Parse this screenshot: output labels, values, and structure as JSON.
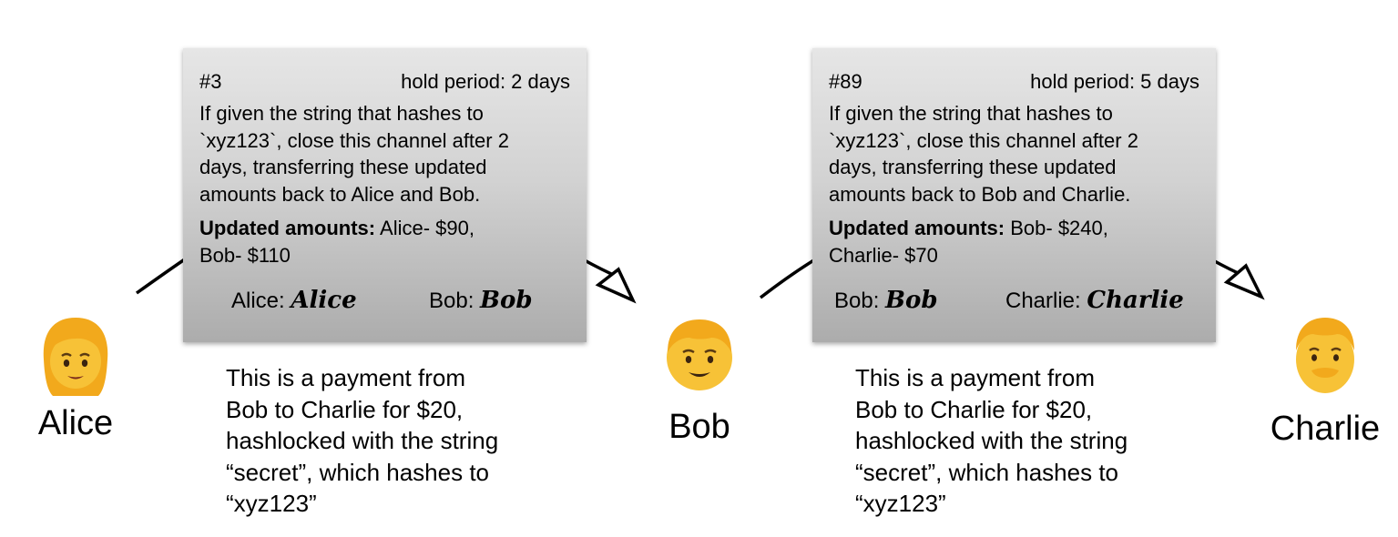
{
  "people": [
    {
      "name": "Alice",
      "emoji": "woman"
    },
    {
      "name": "Bob",
      "emoji": "boy"
    },
    {
      "name": "Charlie",
      "emoji": "man"
    }
  ],
  "cards": [
    {
      "number": "#3",
      "hold_period": "hold period: 2 days",
      "body_lines": [
        "If given the string that hashes to",
        "`xyz123`, close this channel after 2",
        "days, transferring these updated",
        "amounts back to Alice and Bob."
      ],
      "amounts_label": "Updated amounts:",
      "amounts_line1": " Alice- $90,",
      "amounts_line2": "Bob- $110",
      "signatures": [
        {
          "label": "Alice:",
          "sig": "Alice"
        },
        {
          "label": "Bob:",
          "sig": "Bob"
        }
      ]
    },
    {
      "number": "#89",
      "hold_period": "hold period: 5 days",
      "body_lines": [
        "If given the string that hashes to",
        "`xyz123`, close this channel after 2",
        "days, transferring these updated",
        "amounts back to Bob and Charlie."
      ],
      "amounts_label": "Updated amounts:",
      "amounts_line1": " Bob- $240,",
      "amounts_line2": "Charlie- $70",
      "signatures": [
        {
          "label": "Bob:",
          "sig": "Bob"
        },
        {
          "label": "Charlie:",
          "sig": "Charlie"
        }
      ]
    }
  ],
  "captions": [
    [
      "This is a payment from",
      "Bob to Charlie for $20,",
      "hashlocked with the string",
      "“secret”, which hashes to",
      "“xyz123”"
    ],
    [
      "This is a payment from",
      "Bob to Charlie for $20,",
      "hashlocked with the string",
      "“secret”, which hashes to",
      "“xyz123”"
    ]
  ],
  "colors": {
    "emoji_skin": "#f7c237",
    "emoji_hair": "#f2a91c",
    "card_top": "#e6e6e6",
    "card_bottom": "#acacac"
  }
}
